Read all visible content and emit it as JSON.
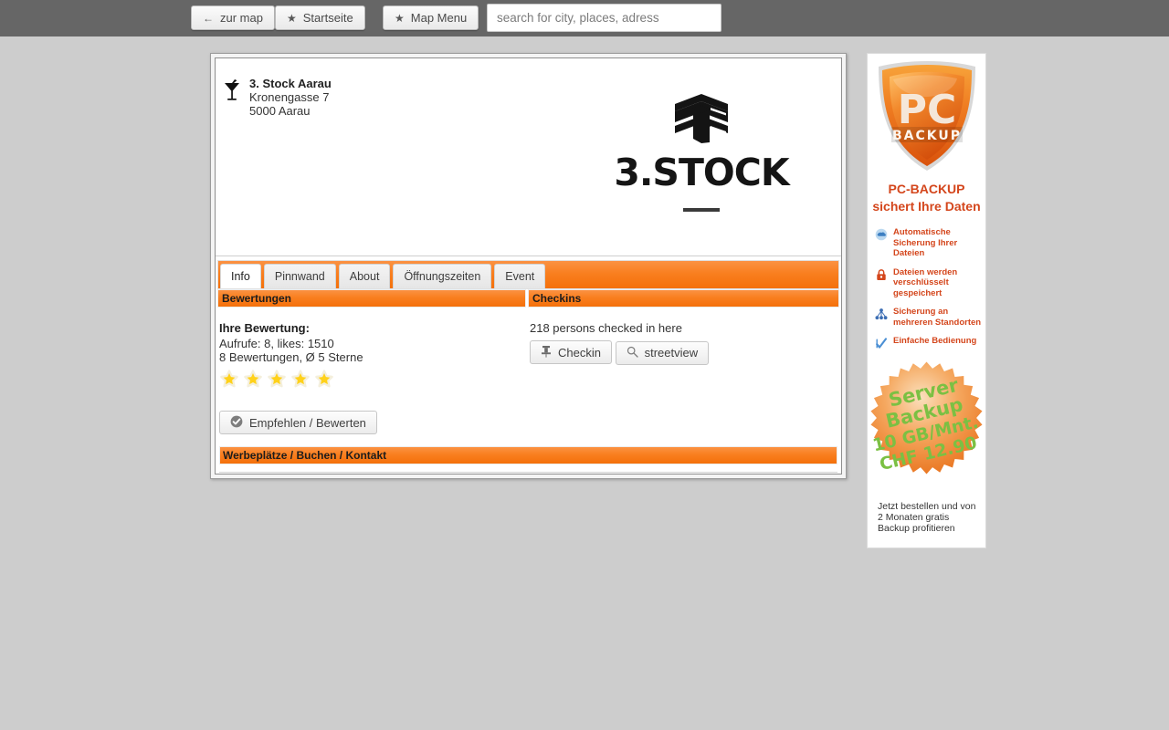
{
  "topbar": {
    "buttons": [
      {
        "id": "zur-map",
        "icon": "arrow-left-icon",
        "glyph": "←",
        "label": "zur map"
      },
      {
        "id": "startseite",
        "icon": "star-icon",
        "glyph": "★",
        "label": "Startseite"
      },
      {
        "id": "map-menu",
        "icon": "star-icon",
        "glyph": "★",
        "label": "Map Menu"
      }
    ],
    "search": {
      "placeholder": "search for city, places, adress",
      "value": ""
    }
  },
  "venue": {
    "icon": "cocktail-glass-icon",
    "name": "3. Stock Aarau",
    "street": "Kronengasse 7",
    "city": "5000 Aarau",
    "logo": {
      "icon": "stacked-floors-icon",
      "wordmark": "3.STOCK"
    }
  },
  "tabs": [
    {
      "label": "Info",
      "active": true
    },
    {
      "label": "Pinnwand",
      "active": false
    },
    {
      "label": "About",
      "active": false
    },
    {
      "label": "Öffnungszeiten",
      "active": false
    },
    {
      "label": "Event",
      "active": false
    }
  ],
  "sections": {
    "left_title": "Bewertungen",
    "right_title": "Checkins"
  },
  "ratings": {
    "heading": "Ihre Bewertung:",
    "stats": "Aufrufe: 8, likes: 1510",
    "summary": "8 Bewertungen, Ø 5 Sterne",
    "stars_filled": 5,
    "stars_total": 5,
    "star_color": "#ffd11a",
    "recommend_button": {
      "label": "Empfehlen / Bewerten",
      "icon": "check-circle-icon"
    }
  },
  "checkins": {
    "count_text": "218 persons checked in here",
    "checkin_button": {
      "label": "Checkin",
      "icon": "pin-icon"
    },
    "streetview_button": {
      "label": "streetview",
      "icon": "magnifier-icon"
    }
  },
  "footer_bar": {
    "label": "Werbeplätze / Buchen / Kontakt"
  },
  "ad": {
    "shield": {
      "title": "PC",
      "sub": "BACKUP"
    },
    "headline_line1": "PC-BACKUP",
    "headline_line2": "sichert Ihre Daten",
    "features": [
      {
        "icon": "cloud-sync-icon",
        "color": "#5b9bd5",
        "text": "Automatische Sicherung Ihrer Dateien"
      },
      {
        "icon": "lock-icon",
        "color": "#d4461c",
        "text": "Dateien werden verschlüsselt gespeichert"
      },
      {
        "icon": "network-icon",
        "color": "#3c6eb4",
        "text": "Sicherung an mehreren Standorten"
      },
      {
        "icon": "check-flag-icon",
        "color": "#4a8fd4",
        "text": "Einfache Bedienung"
      }
    ],
    "badge": {
      "line1": "Server",
      "line2": "Backup",
      "line3": "10 GB/Mnt.",
      "line4": "CHF 12.90",
      "text_color": "#7bc043"
    },
    "footer_text": "Jetzt bestellen und von 2 Monaten gratis Backup profitieren"
  },
  "colors": {
    "accent_orange": "#f4700a",
    "topbar_gray": "#666666",
    "page_bg": "#cdcdcd",
    "ad_red": "#d4461c"
  }
}
